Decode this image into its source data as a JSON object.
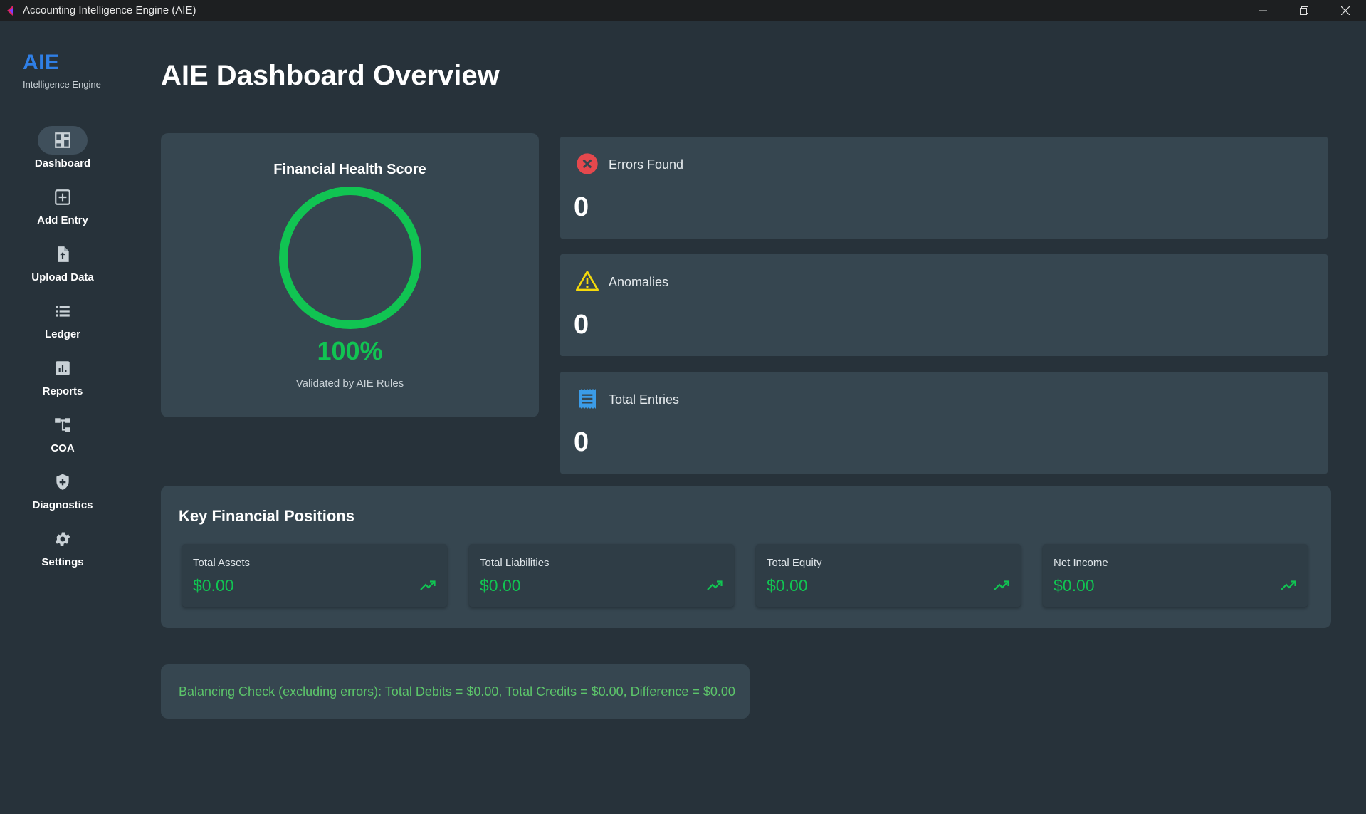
{
  "window": {
    "title": "Accounting Intelligence Engine (AIE)",
    "controls": [
      "minimize-icon",
      "restore-icon",
      "close-icon"
    ]
  },
  "brand": {
    "name": "AIE",
    "subtitle": "Intelligence Engine"
  },
  "sidebar": {
    "items": [
      {
        "label": "Dashboard",
        "icon": "dashboard-icon",
        "active": true
      },
      {
        "label": "Add Entry",
        "icon": "add-box-icon",
        "active": false
      },
      {
        "label": "Upload Data",
        "icon": "upload-file-icon",
        "active": false
      },
      {
        "label": "Ledger",
        "icon": "list-icon",
        "active": false
      },
      {
        "label": "Reports",
        "icon": "bar-chart-icon",
        "active": false
      },
      {
        "label": "COA",
        "icon": "account-tree-icon",
        "active": false
      },
      {
        "label": "Diagnostics",
        "icon": "shield-icon",
        "active": false
      },
      {
        "label": "Settings",
        "icon": "gear-icon",
        "active": false
      }
    ]
  },
  "main": {
    "title": "AIE Dashboard Overview",
    "health": {
      "title": "Financial Health Score",
      "score": "100%",
      "score_fraction": 1.0,
      "caption": "Validated by AIE Rules"
    },
    "stats": [
      {
        "label": "Errors Found",
        "value": "0",
        "icon": "error-icon"
      },
      {
        "label": "Anomalies",
        "value": "0",
        "icon": "warning-icon"
      },
      {
        "label": "Total Entries",
        "value": "0",
        "icon": "receipt-icon"
      }
    ],
    "positions": {
      "title": "Key Financial Positions",
      "items": [
        {
          "label": "Total Assets",
          "value": "$0.00",
          "icon": "trending-up-icon"
        },
        {
          "label": "Total Liabilities",
          "value": "$0.00",
          "icon": "trending-up-icon"
        },
        {
          "label": "Total Equity",
          "value": "$0.00",
          "icon": "trending-up-icon"
        },
        {
          "label": "Net Income",
          "value": "$0.00",
          "icon": "trending-up-icon"
        }
      ]
    },
    "balance_check": "Balancing Check (excluding errors): Total Debits = $0.00, Total Credits = $0.00, Difference = $0.00"
  },
  "colors": {
    "background": "#27323a",
    "card": "#364650",
    "accent_blue": "#2f7fe6",
    "success_green": "#11c452",
    "error_red": "#e5484d",
    "warning_yellow": "#f5d90a",
    "info_blue": "#3b9ce8"
  }
}
